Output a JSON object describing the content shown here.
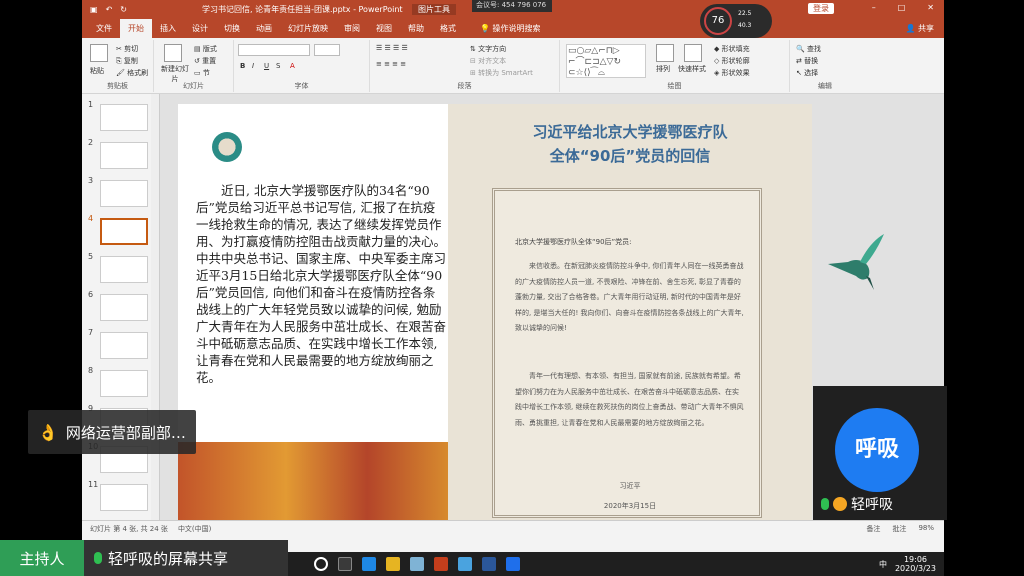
{
  "titlebar": {
    "title": "学习书记回信, 论青年责任担当-团课.pptx - PowerPoint",
    "picture_tools": "图片工具",
    "login": "登录",
    "meeting_id": "会议号: 454 796 076"
  },
  "tabs": [
    "文件",
    "开始",
    "插入",
    "设计",
    "切换",
    "动画",
    "幻灯片放映",
    "审阅",
    "视图",
    "帮助",
    "格式"
  ],
  "tell_me": "操作说明搜索",
  "share": "共享",
  "ribbon": {
    "clipboard": {
      "cut": "剪切",
      "copy": "复制",
      "paste": "粘贴",
      "format_painter": "格式刷",
      "label": "剪贴板"
    },
    "slides": {
      "new_slide": "新建幻灯片",
      "layout": "版式",
      "reset": "重置",
      "section": "节",
      "label": "幻灯片"
    },
    "font": {
      "label": "字体"
    },
    "paragraph": {
      "text_direction": "文字方向",
      "align_text": "对齐文本",
      "smartart": "转换为 SmartArt",
      "label": "段落"
    },
    "drawing": {
      "arrange": "排列",
      "quick_styles": "快速样式",
      "fill": "形状填充",
      "outline": "形状轮廓",
      "effects": "形状效果",
      "label": "绘图"
    },
    "editing": {
      "find": "查找",
      "replace": "替换",
      "select": "选择",
      "label": "编辑"
    }
  },
  "gauge": {
    "percent": "76",
    "stat1": "22.5",
    "stat2": "40.3"
  },
  "thumbnails": [
    "1",
    "2",
    "3",
    "4",
    "5",
    "6",
    "7",
    "8",
    "9",
    "10",
    "11"
  ],
  "slide": {
    "body": "近日, 北京大学援鄂医疗队的34名“90后”党员给习近平总书记写信, 汇报了在抗疫一线抢救生命的情况, 表达了继续发挥党员作用、为打赢疫情防控阻击战贡献力量的决心。中共中央总书记、国家主席、中央军委主席习近平3月15日给北京大学援鄂医疗队全体“90后”党员回信, 向他们和奋斗在疫情防控各条战线上的广大年轻党员致以诚挚的问候, 勉励广大青年在为人民服务中茁壮成长、在艰苦奋斗中砥砺意志品质、在实践中增长工作本领, 让青春在党和人民最需要的地方绽放绚丽之花。",
    "letter_title_1": "习近平给北京大学援鄂医疗队",
    "letter_title_2": "全体“90后”党员的回信",
    "letter_salutation": "北京大学援鄂医疗队全体“90后”党员:",
    "letter_para1": "来信收悉。在新冠肺炎疫情防控斗争中, 你们青年人同在一线英勇奋战的广大疫情防控人员一道, 不畏艰险、冲锋在前、舍生忘死, 彰显了青春的蓬勃力量, 交出了合格答卷。广大青年用行动证明, 新时代的中国青年是好样的, 是堪当大任的! 我向你们、向奋斗在疫情防控各条战线上的广大青年, 致以诚挚的问候!",
    "letter_para2": "青年一代有理想、有本领、有担当, 国家就有前途, 民族就有希望。希望你们努力在为人民服务中茁壮成长、在艰苦奋斗中砥砺意志品质、在实践中增长工作本领, 继续在救死扶伤的岗位上奋勇战、带动广大青年不惧风雨、勇挑重担, 让青春在党和人民最需要的地方绽放绚丽之花。",
    "letter_sign": "习近平",
    "letter_date": "2020年3月15日"
  },
  "statusbar": {
    "slide_info": "幻灯片 第 4 张, 共 24 张",
    "lang": "中文(中国)",
    "notes": "备注",
    "comments": "批注",
    "zoom": "98%"
  },
  "taskbar": {
    "time": "19:06",
    "date": "2020/3/23",
    "ime": "中"
  },
  "overlay": {
    "user_name": "网络运营部副部…",
    "host_label": "主持人",
    "host_share": "轻呼吸的屏幕共享",
    "cam_avatar_text": "呼吸",
    "cam_name": "轻呼吸"
  }
}
